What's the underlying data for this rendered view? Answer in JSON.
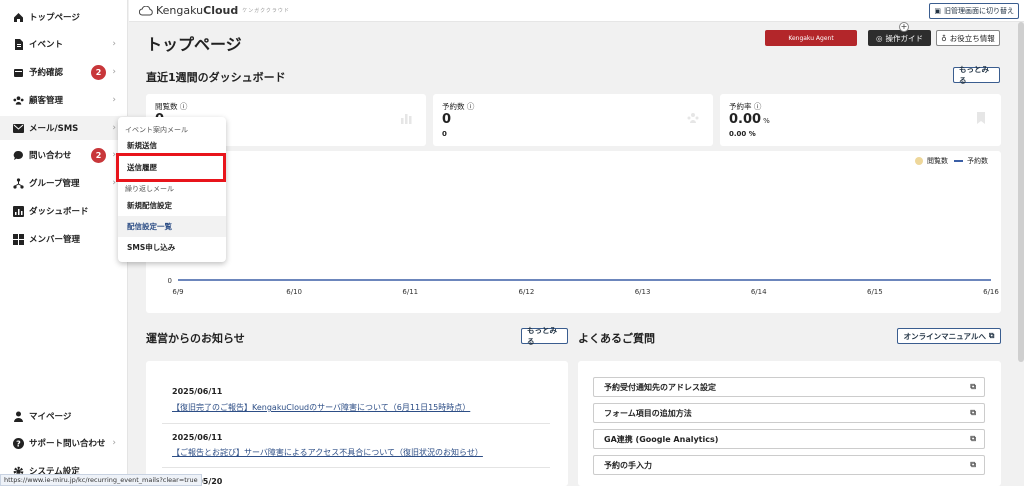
{
  "sidebar": {
    "items": [
      {
        "label": "トップページ",
        "icon": "home-icon"
      },
      {
        "label": "イベント",
        "icon": "document-icon"
      },
      {
        "label": "予約確認",
        "icon": "calendar-icon",
        "badge": "2"
      },
      {
        "label": "顧客管理",
        "icon": "users-icon"
      },
      {
        "label": "メール/SMS",
        "icon": "mail-icon"
      },
      {
        "label": "問い合わせ",
        "icon": "chat-icon",
        "badge": "2"
      },
      {
        "label": "グループ管理",
        "icon": "network-icon"
      },
      {
        "label": "ダッシュボード",
        "icon": "chart-icon"
      },
      {
        "label": "メンバー管理",
        "icon": "grid-icon"
      }
    ],
    "bottom_items": [
      {
        "label": "マイページ",
        "icon": "person-icon"
      },
      {
        "label": "サポート問い合わせ",
        "icon": "help-icon"
      },
      {
        "label": "システム設定",
        "icon": "gear-icon"
      }
    ]
  },
  "topbar": {
    "logo_prefix": "Kengaku",
    "logo_suffix": "Cloud",
    "logo_tag": "ケンガククラウド",
    "old_admin_label": "旧管理画面に切り替え"
  },
  "header": {
    "title": "トップページ",
    "agent_label": "Kengaku Agent",
    "guide_label": "操作ガイド",
    "tips_label": "お役立ち情報"
  },
  "dashboard": {
    "title": "直近1週間のダッシュボード",
    "more_label": "もっとみる",
    "stats": [
      {
        "label": "閲覧数",
        "value": "0",
        "sub": ""
      },
      {
        "label": "予約数",
        "value": "0",
        "sub": "0"
      },
      {
        "label": "予約率",
        "value": "0.00",
        "unit": "%",
        "sub": "0.00 %"
      }
    ]
  },
  "chart_data": {
    "type": "line",
    "x": [
      "6/9",
      "6/10",
      "6/11",
      "6/12",
      "6/13",
      "6/14",
      "6/15",
      "6/16"
    ],
    "series": [
      {
        "name": "閲覧数",
        "values": [
          0,
          0,
          0,
          0,
          0,
          0,
          0,
          0
        ],
        "color": "#eed79a"
      },
      {
        "name": "予約数",
        "values": [
          0,
          0,
          0,
          0,
          0,
          0,
          0,
          0
        ],
        "color": "#3b5fa6"
      }
    ],
    "y_tick": "0",
    "legend": "top-right"
  },
  "dropdown": {
    "section1": "イベント案内メール",
    "items1": [
      "新規送信",
      "送信履歴"
    ],
    "section2": "繰り返しメール",
    "items2": [
      "新規配信設定",
      "配信設定一覧",
      "SMS申し込み"
    ]
  },
  "news": {
    "title": "運営からのお知らせ",
    "more_label": "もっとみる",
    "items": [
      {
        "date": "2025/06/11",
        "text": "【復旧完了のご報告】KengakuCloudのサーバ障害について（6月11日15時時点）"
      },
      {
        "date": "2025/06/11",
        "text": "【ご報告とお詫び】サーバ障害によるアクセス不具合について（復旧状況のお知らせ）"
      },
      {
        "date": "2025/05/20",
        "text": ""
      }
    ]
  },
  "faq": {
    "title": "よくあるご質問",
    "manual_label": "オンラインマニュアルへ",
    "items": [
      "予約受付通知先のアドレス設定",
      "フォーム項目の追加方法",
      "GA連携 (Google Analytics)",
      "予約の手入力"
    ]
  },
  "status_url": "https://www.ie-miru.jp/kc/recurring_event_mails?clear=true"
}
